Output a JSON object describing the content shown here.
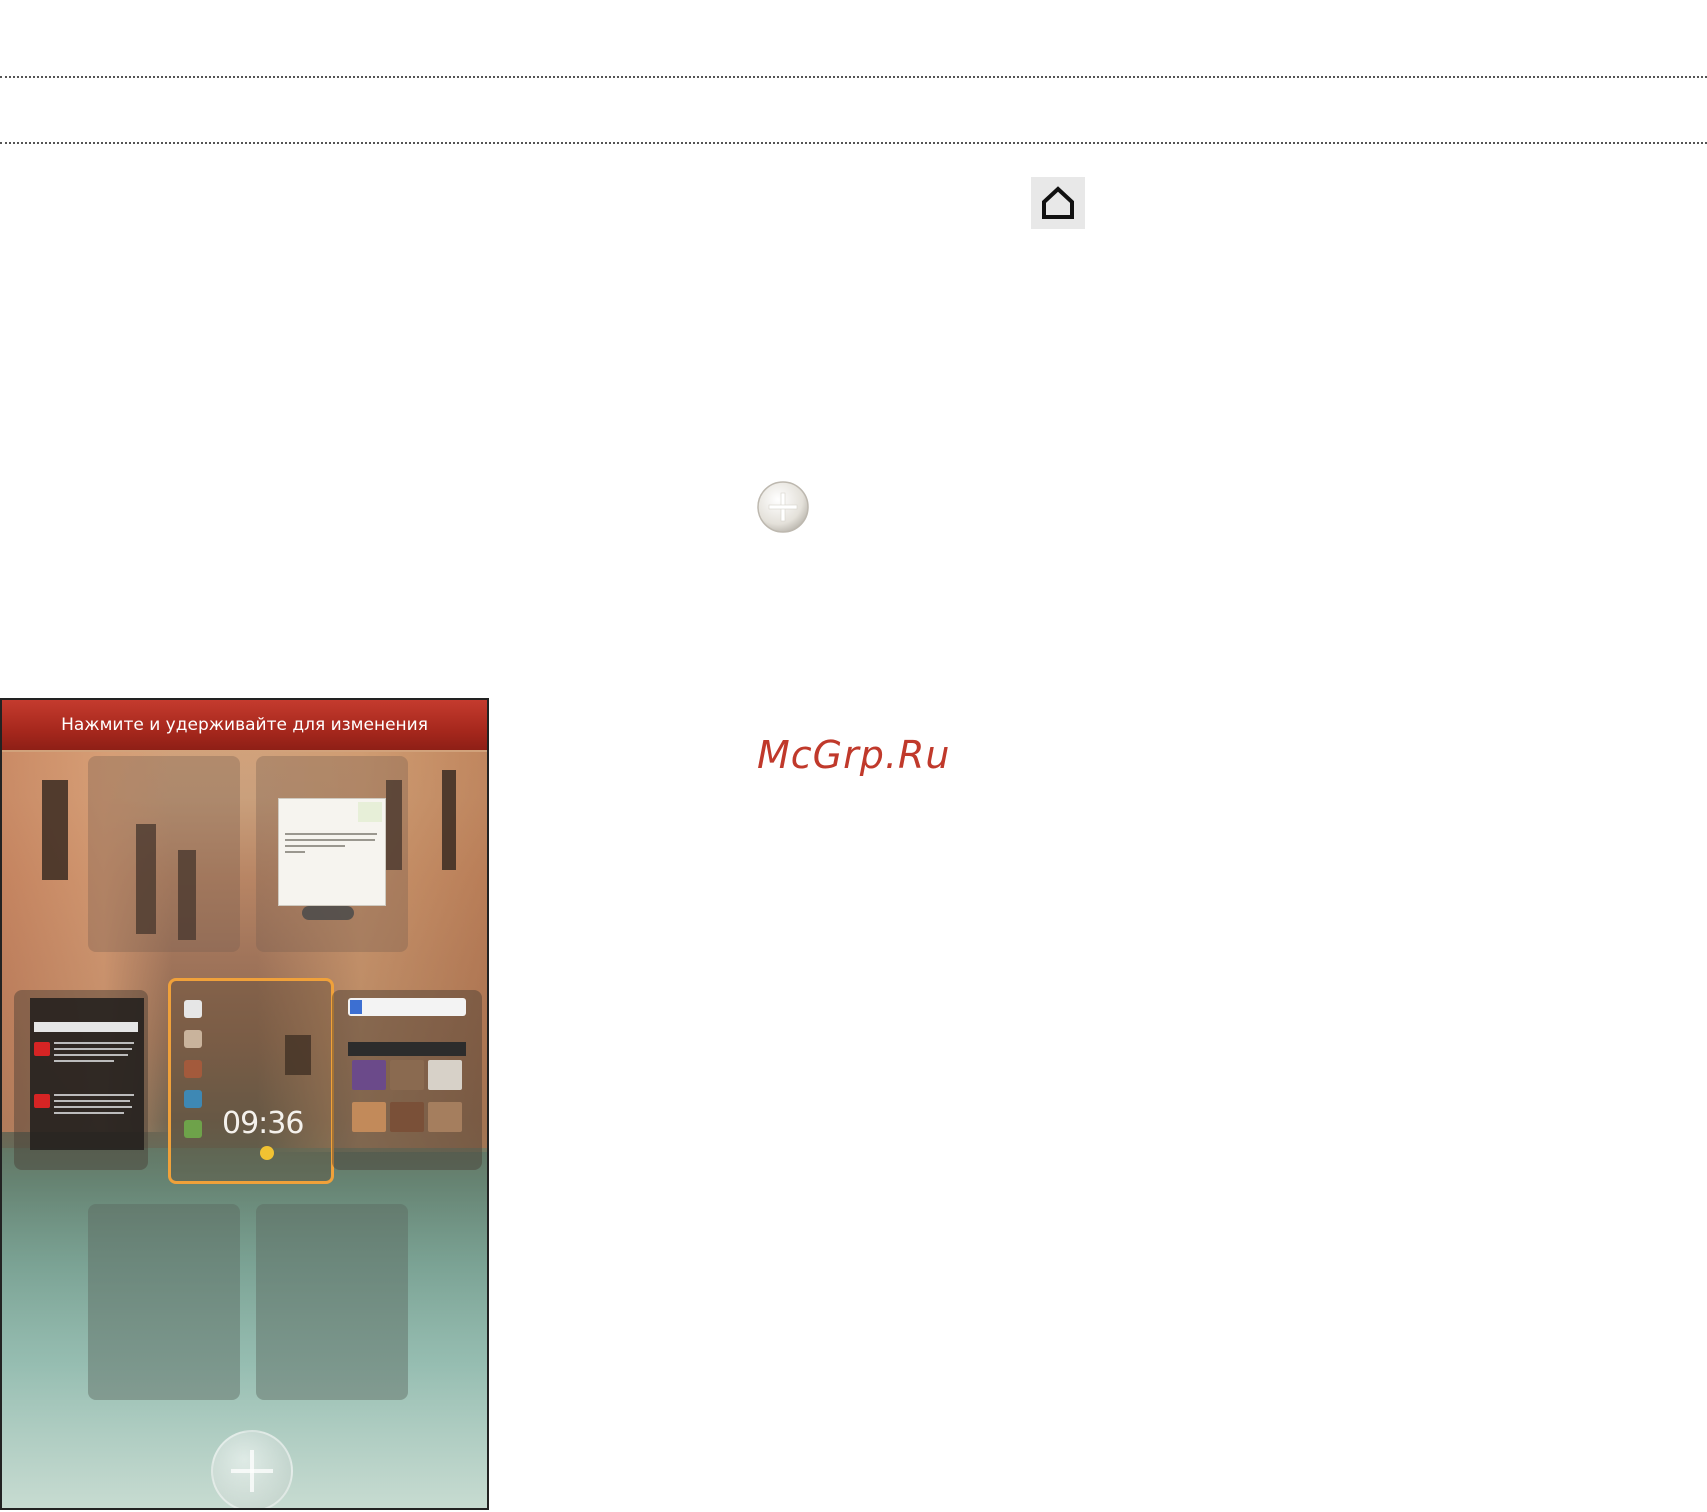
{
  "page": {
    "watermark": "McGrp.Ru",
    "colors": {
      "watermark": "#c0392b",
      "header_bar": "#a7281d",
      "highlight": "#f0a13a"
    }
  },
  "icons": {
    "home": "home-icon",
    "plus": "plus-circle-icon"
  },
  "phone": {
    "header_text": "Нажмите и удерживайте для изменения",
    "clock_time": "09:36"
  }
}
